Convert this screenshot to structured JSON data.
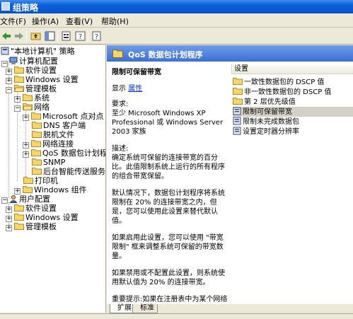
{
  "window": {
    "title": "组策略"
  },
  "menu": {
    "file": "文件(F)",
    "action": "操作(A)",
    "view": "查看(V)",
    "help": "帮助(H)"
  },
  "toolbar": {
    "back_icon": "back-arrow-icon",
    "forward_icon": "forward-arrow-icon",
    "up_icon": "up-folder-icon",
    "show_tree_icon": "show-hide-tree-icon",
    "properties_icon": "properties-icon",
    "help_icon": "help-icon",
    "extra_icon": "help-book-icon"
  },
  "tree": {
    "root": "\"本地计算机\" 策略",
    "computer_config": "计算机配置",
    "software_settings": "软件设置",
    "windows_settings": "Windows 设置",
    "admin_templates": "管理模板",
    "system": "系统",
    "network": "网络",
    "ms_client": "Microsoft 点对点",
    "dns_client": "DNS 客户端",
    "offline_files": "脱机文件",
    "network_connections": "网络连接",
    "qos": "QoS 数据包计划程序",
    "snmp": "SNMP",
    "bits": "后台智能传送服务",
    "printers": "打印机",
    "windows_components": "Windows 组件",
    "user_config": "用户配置",
    "user_software": "软件设置",
    "user_windows": "Windows 设置",
    "user_admin": "管理模板"
  },
  "right": {
    "header": "QoS 数据包计划程序",
    "desc": {
      "title": "限制可保留带宽",
      "show_label": "显示",
      "properties_link": "属性",
      "req_label": "要求:",
      "req_text": "至少 Microsoft Windows XP Professional 或 Windows Server 2003 家族",
      "desc_label": "描述:",
      "p1": "确定系统可保留的连接带宽的百分比。此值限制系统上运行的所有程序的组合带宽保留。",
      "p2": "默认情况下，数据包计划程序将系统限制在 20% 的连接带宽之内，但是，您可以使用此设置来替代默认值。",
      "p3": "如果启用此设置，您可以使用 \"带宽限制\" 框来调整系统可保留的带宽数量。",
      "p4": "如果禁用或不配置此设置，则系统使用默认值为 20% 的连接带宽。",
      "p5": "重要提示:如果在注册表中为某个网络适配器设置带宽限制，配置该网络适配器时就会忽略此设置。"
    },
    "settings_header": "设置",
    "settings": [
      {
        "label": "一致性数据包的 DSCP 值",
        "icon": "folder-icon"
      },
      {
        "label": "非一致性数据包的 DSCP 值",
        "icon": "folder-icon"
      },
      {
        "label": "第 2 层优先级值",
        "icon": "folder-icon"
      },
      {
        "label": "限制可保留带宽",
        "icon": "setting-icon"
      },
      {
        "label": "限制未完成数据包",
        "icon": "setting-icon"
      },
      {
        "label": "设置定时器分辨率",
        "icon": "setting-icon"
      }
    ]
  },
  "tabs": {
    "extended": "扩展",
    "standard": "标准"
  },
  "colors": {
    "titlebar": "#0a5fd8",
    "header": "#4a7ddc",
    "link": "#0033cc",
    "selection": "#d4d0c8"
  }
}
